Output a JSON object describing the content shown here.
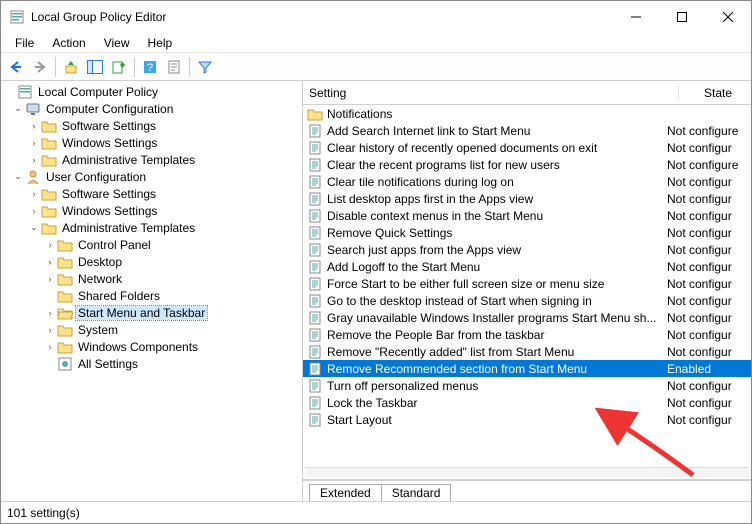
{
  "window": {
    "title": "Local Group Policy Editor"
  },
  "menu": {
    "file": "File",
    "action": "Action",
    "view": "View",
    "help": "Help"
  },
  "tree": {
    "root": "Local Computer Policy",
    "cc": "Computer Configuration",
    "cc_sw": "Software Settings",
    "cc_win": "Windows Settings",
    "cc_adm": "Administrative Templates",
    "uc": "User Configuration",
    "uc_sw": "Software Settings",
    "uc_win": "Windows Settings",
    "uc_adm": "Administrative Templates",
    "cp": "Control Panel",
    "dt": "Desktop",
    "nw": "Network",
    "sf": "Shared Folders",
    "smt": "Start Menu and Taskbar",
    "sys": "System",
    "wc": "Windows Components",
    "as": "All Settings"
  },
  "list": {
    "header": {
      "setting": "Setting",
      "state": "State"
    },
    "items": [
      {
        "label": "Notifications",
        "state": "",
        "type": "folder"
      },
      {
        "label": "Add Search Internet link to Start Menu",
        "state": "Not configure",
        "type": "policy"
      },
      {
        "label": "Clear history of recently opened documents on exit",
        "state": "Not configur",
        "type": "policy"
      },
      {
        "label": "Clear the recent programs list for new users",
        "state": "Not configure",
        "type": "policy"
      },
      {
        "label": "Clear tile notifications during log on",
        "state": "Not configur",
        "type": "policy"
      },
      {
        "label": "List desktop apps first in the Apps view",
        "state": "Not configur",
        "type": "policy"
      },
      {
        "label": "Disable context menus in the Start Menu",
        "state": "Not configur",
        "type": "policy"
      },
      {
        "label": "Remove Quick Settings",
        "state": "Not configur",
        "type": "policy"
      },
      {
        "label": "Search just apps from the Apps view",
        "state": "Not configur",
        "type": "policy"
      },
      {
        "label": "Add Logoff to the Start Menu",
        "state": "Not configur",
        "type": "policy"
      },
      {
        "label": "Force Start to be either full screen size or menu size",
        "state": "Not configur",
        "type": "policy"
      },
      {
        "label": "Go to the desktop instead of Start when signing in",
        "state": "Not configur",
        "type": "policy"
      },
      {
        "label": "Gray unavailable Windows Installer programs Start Menu sh...",
        "state": "Not configur",
        "type": "policy"
      },
      {
        "label": "Remove the People Bar from the taskbar",
        "state": "Not configur",
        "type": "policy"
      },
      {
        "label": "Remove \"Recently added\" list from Start Menu",
        "state": "Not configur",
        "type": "policy"
      },
      {
        "label": "Remove Recommended section from Start Menu",
        "state": "Enabled",
        "type": "policy",
        "selected": true
      },
      {
        "label": "Turn off personalized menus",
        "state": "Not configur",
        "type": "policy"
      },
      {
        "label": "Lock the Taskbar",
        "state": "Not configur",
        "type": "policy"
      },
      {
        "label": "Start Layout",
        "state": "Not configur",
        "type": "policy"
      }
    ]
  },
  "tabs": {
    "extended": "Extended",
    "standard": "Standard"
  },
  "status": {
    "text": "101 setting(s)"
  }
}
